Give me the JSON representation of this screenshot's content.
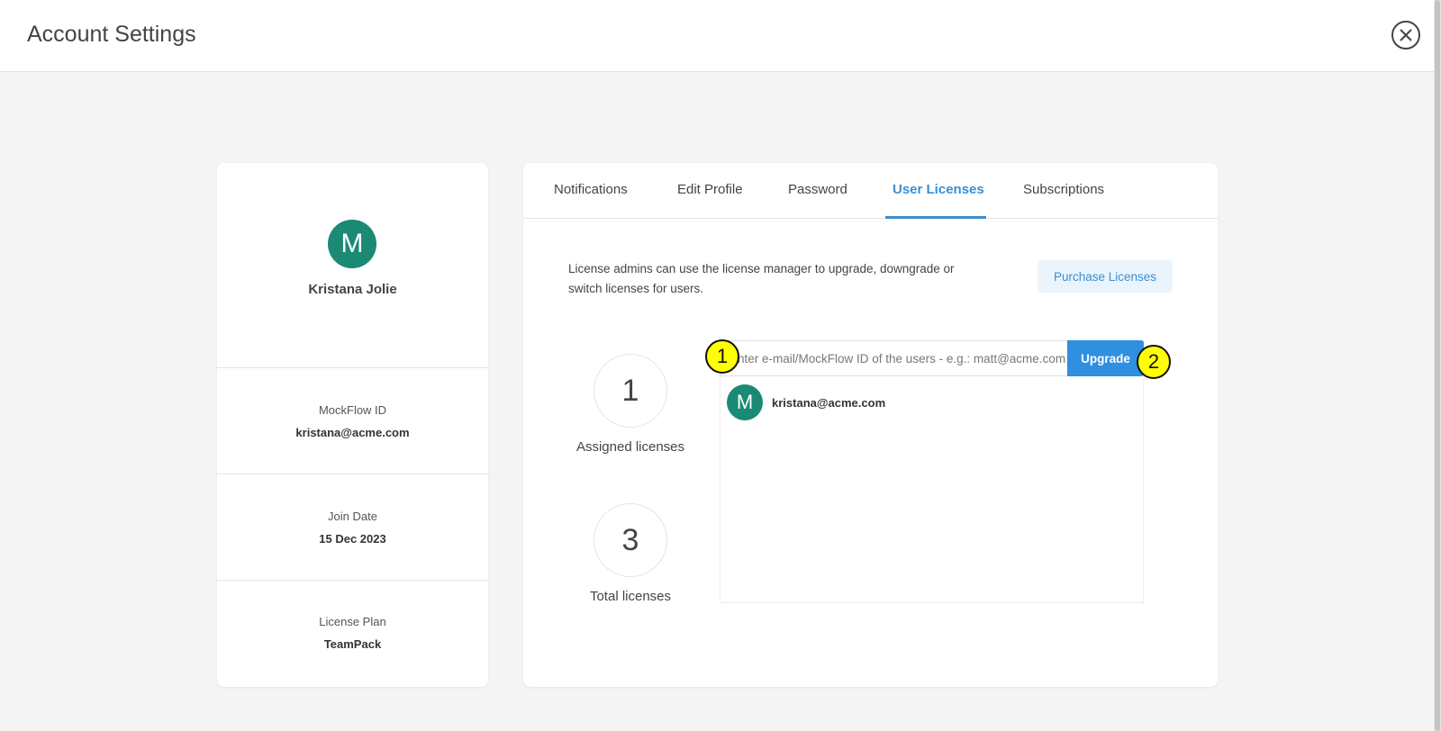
{
  "header": {
    "title": "Account Settings",
    "close_icon": "close-icon"
  },
  "profile": {
    "avatar_letter": "M",
    "avatar_color": "#1a8a75",
    "name": "Kristana Jolie",
    "fields": [
      {
        "label": "MockFlow ID",
        "value": "kristana@acme.com"
      },
      {
        "label": "Join Date",
        "value": "15 Dec 2023"
      },
      {
        "label": "License Plan",
        "value": "TeamPack"
      }
    ]
  },
  "tabs": [
    {
      "label": "Notifications"
    },
    {
      "label": "Edit Profile"
    },
    {
      "label": "Password"
    },
    {
      "label": "User Licenses",
      "active": true
    },
    {
      "label": "Subscriptions"
    }
  ],
  "licenses": {
    "description": "License admins can use the license manager to upgrade, downgrade or switch licenses for users.",
    "purchase_label": "Purchase Licenses",
    "assigned_count": "1",
    "assigned_label": "Assigned licenses",
    "total_count": "3",
    "total_label": "Total licenses",
    "input_placeholder": "Enter e-mail/MockFlow ID of the users - e.g.: matt@acme.com",
    "input_value": "",
    "upgrade_label": "Upgrade",
    "users": [
      {
        "avatar_letter": "M",
        "email": "kristana@acme.com"
      }
    ]
  },
  "annotations": [
    {
      "label": "1"
    },
    {
      "label": "2"
    }
  ],
  "colors": {
    "accent": "#3a8fd1",
    "button": "#2f8fe0",
    "avatar": "#1a8a75",
    "badge": "#ffff00"
  }
}
